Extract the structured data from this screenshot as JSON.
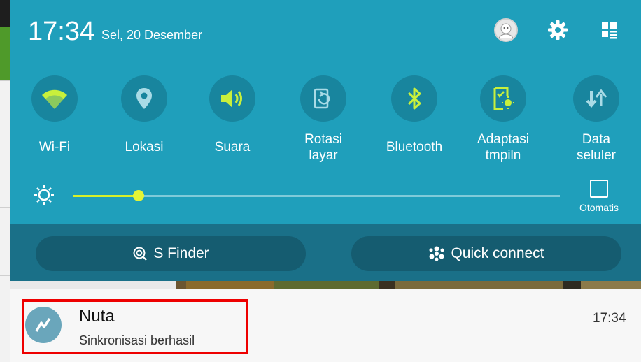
{
  "status": {
    "time": "17:34",
    "date": "Sel, 20 Desember"
  },
  "header_icons": [
    "avatar-icon",
    "gear-icon",
    "edit-grid-icon"
  ],
  "tiles": [
    {
      "label": "Wi-Fi",
      "icon": "wifi-icon"
    },
    {
      "label": "Lokasi",
      "icon": "location-pin-icon"
    },
    {
      "label": "Suara",
      "icon": "speaker-icon"
    },
    {
      "label": "Rotasi\nlayar",
      "icon": "rotate-screen-icon"
    },
    {
      "label": "Bluetooth",
      "icon": "bluetooth-icon"
    },
    {
      "label": "Adaptasi\ntmpiln",
      "icon": "adapt-display-icon"
    },
    {
      "label": "Data\nseluler",
      "icon": "mobile-data-icon"
    }
  ],
  "brightness": {
    "level": 0.135,
    "auto_label": "Otomatis",
    "auto_checked": false
  },
  "actions": {
    "finder": "S Finder",
    "quick_connect": "Quick connect"
  },
  "notification": {
    "app": "Nuta",
    "message": "Sinkronisasi berhasil",
    "time": "17:34",
    "highlight_color": "#ee0000"
  },
  "colors": {
    "panel": "#1f9fbb",
    "tile_circle": "#18859e",
    "active_icon": "#c8f03c",
    "inactive_icon": "#a9dbe6"
  }
}
